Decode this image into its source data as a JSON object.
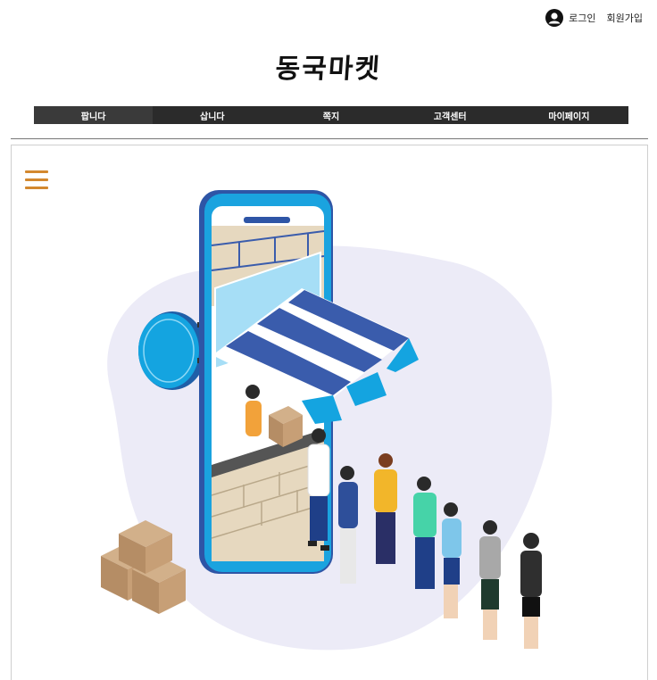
{
  "header": {
    "login_label": "로그인",
    "signup_label": "회원가입",
    "logo_text": "동국마켓"
  },
  "nav": {
    "items": [
      {
        "label": "팝니다"
      },
      {
        "label": "삽니다"
      },
      {
        "label": "쪽지"
      },
      {
        "label": "고객센터"
      },
      {
        "label": "마이페이지"
      }
    ]
  },
  "colors": {
    "nav_bg": "#2b2b2b",
    "hamburger": "#d3882f",
    "phone_blue": "#2c8fd6",
    "blob": "#ecebf7"
  },
  "icons": {
    "user": "user-icon",
    "menu": "hamburger-menu-icon"
  }
}
